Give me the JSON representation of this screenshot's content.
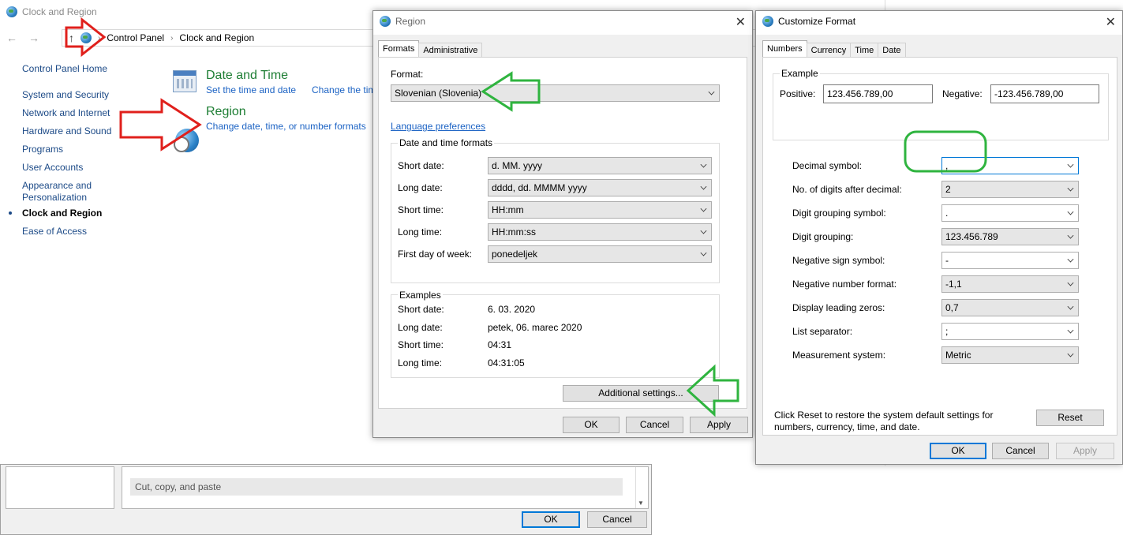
{
  "colors": {
    "link": "#1c63c4",
    "category_title": "#1e7e34",
    "annotation_red": "#e0201c",
    "annotation_green": "#2fb43f",
    "focus_blue": "#0078d7"
  },
  "control_panel": {
    "title": "Clock and Region",
    "breadcrumb": [
      "Control Panel",
      "Clock and Region"
    ],
    "sidebar": {
      "home": "Control Panel Home",
      "items": [
        {
          "label": "System and Security"
        },
        {
          "label": "Network and Internet"
        },
        {
          "label": "Hardware and Sound"
        },
        {
          "label": "Programs"
        },
        {
          "label": "User Accounts"
        },
        {
          "label": "Appearance and\nPersonalization"
        },
        {
          "label": "Clock and Region",
          "current": true
        },
        {
          "label": "Ease of Access"
        }
      ]
    },
    "categories": {
      "date_time": {
        "title": "Date and Time",
        "link1": "Set the time and date",
        "link2": "Change the time zone"
      },
      "region": {
        "title": "Region",
        "link1": "Change date, time, or number formats"
      }
    }
  },
  "bottom_dialog": {
    "section_title": "Cut, copy, and paste",
    "ok": "OK",
    "cancel": "Cancel"
  },
  "region_dialog": {
    "title": "Region",
    "tabs": [
      "Formats",
      "Administrative"
    ],
    "format_label": "Format:",
    "format_value": "Slovenian (Slovenia)",
    "language_prefs": "Language preferences",
    "dt_group": "Date and time formats",
    "dt_rows": [
      {
        "label": "Short date:",
        "value": "d. MM. yyyy"
      },
      {
        "label": "Long date:",
        "value": "dddd, dd. MMMM yyyy"
      },
      {
        "label": "Short time:",
        "value": "HH:mm"
      },
      {
        "label": "Long time:",
        "value": "HH:mm:ss"
      },
      {
        "label": "First day of week:",
        "value": "ponedeljek"
      }
    ],
    "examples_group": "Examples",
    "examples": [
      {
        "label": "Short date:",
        "value": "6. 03. 2020"
      },
      {
        "label": "Long date:",
        "value": "petek, 06. marec 2020"
      },
      {
        "label": "Short time:",
        "value": "04:31"
      },
      {
        "label": "Long time:",
        "value": "04:31:05"
      }
    ],
    "additional_settings": "Additional settings...",
    "ok": "OK",
    "cancel": "Cancel",
    "apply": "Apply"
  },
  "customize_dialog": {
    "title": "Customize Format",
    "tabs": [
      "Numbers",
      "Currency",
      "Time",
      "Date"
    ],
    "example_group": "Example",
    "positive_label": "Positive:",
    "positive_value": "123.456.789,00",
    "negative_label": "Negative:",
    "negative_value": "-123.456.789,00",
    "rows": [
      {
        "label": "Decimal symbol:",
        "value": ","
      },
      {
        "label": "No. of digits after decimal:",
        "value": "2"
      },
      {
        "label": "Digit grouping symbol:",
        "value": "."
      },
      {
        "label": "Digit grouping:",
        "value": "123.456.789"
      },
      {
        "label": "Negative sign symbol:",
        "value": "-"
      },
      {
        "label": "Negative number format:",
        "value": "-1,1"
      },
      {
        "label": "Display leading zeros:",
        "value": "0,7"
      },
      {
        "label": "List separator:",
        "value": ";"
      },
      {
        "label": "Measurement system:",
        "value": "Metric"
      }
    ],
    "reset_note": "Click Reset to restore the system default settings for\nnumbers, currency, time, and date.",
    "reset": "Reset",
    "ok": "OK",
    "cancel": "Cancel",
    "apply": "Apply"
  }
}
